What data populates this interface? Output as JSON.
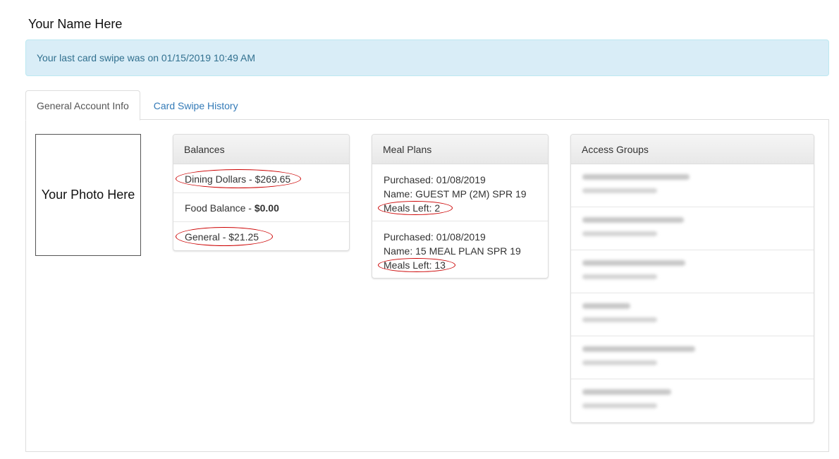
{
  "user": {
    "name": "Your Name Here"
  },
  "alert": {
    "message": "Your last card swipe was on 01/15/2019 10:49 AM"
  },
  "tabs": [
    {
      "label": "General Account Info",
      "active": true
    },
    {
      "label": "Card Swipe History",
      "active": false
    }
  ],
  "photo": {
    "placeholder": "Your Photo Here"
  },
  "balances": {
    "title": "Balances",
    "items": [
      {
        "label": "Dining Dollars - ",
        "amount": "$269.65",
        "highlighted": true
      },
      {
        "label": "Food Balance - ",
        "amount": "$0.00",
        "highlighted": false
      },
      {
        "label": "General - ",
        "amount": "$21.25",
        "highlighted": true
      }
    ]
  },
  "meal_plans": {
    "title": "Meal Plans",
    "items": [
      {
        "purchased": "Purchased: 01/08/2019",
        "name": "Name: GUEST MP (2M) SPR 19",
        "meals_left": "Meals Left: 2"
      },
      {
        "purchased": "Purchased: 01/08/2019",
        "name": "Name: 15 MEAL PLAN SPR 19",
        "meals_left": "Meals Left: 13"
      }
    ]
  },
  "access_groups": {
    "title": "Access Groups",
    "items": [
      {
        "redacted": true
      },
      {
        "redacted": true
      },
      {
        "redacted": true
      },
      {
        "redacted": true
      },
      {
        "redacted": true
      },
      {
        "redacted": true
      }
    ]
  },
  "colors": {
    "alert_bg": "#d9edf7",
    "alert_text": "#31708f",
    "link": "#337ab7",
    "annotation": "#cc0000"
  }
}
